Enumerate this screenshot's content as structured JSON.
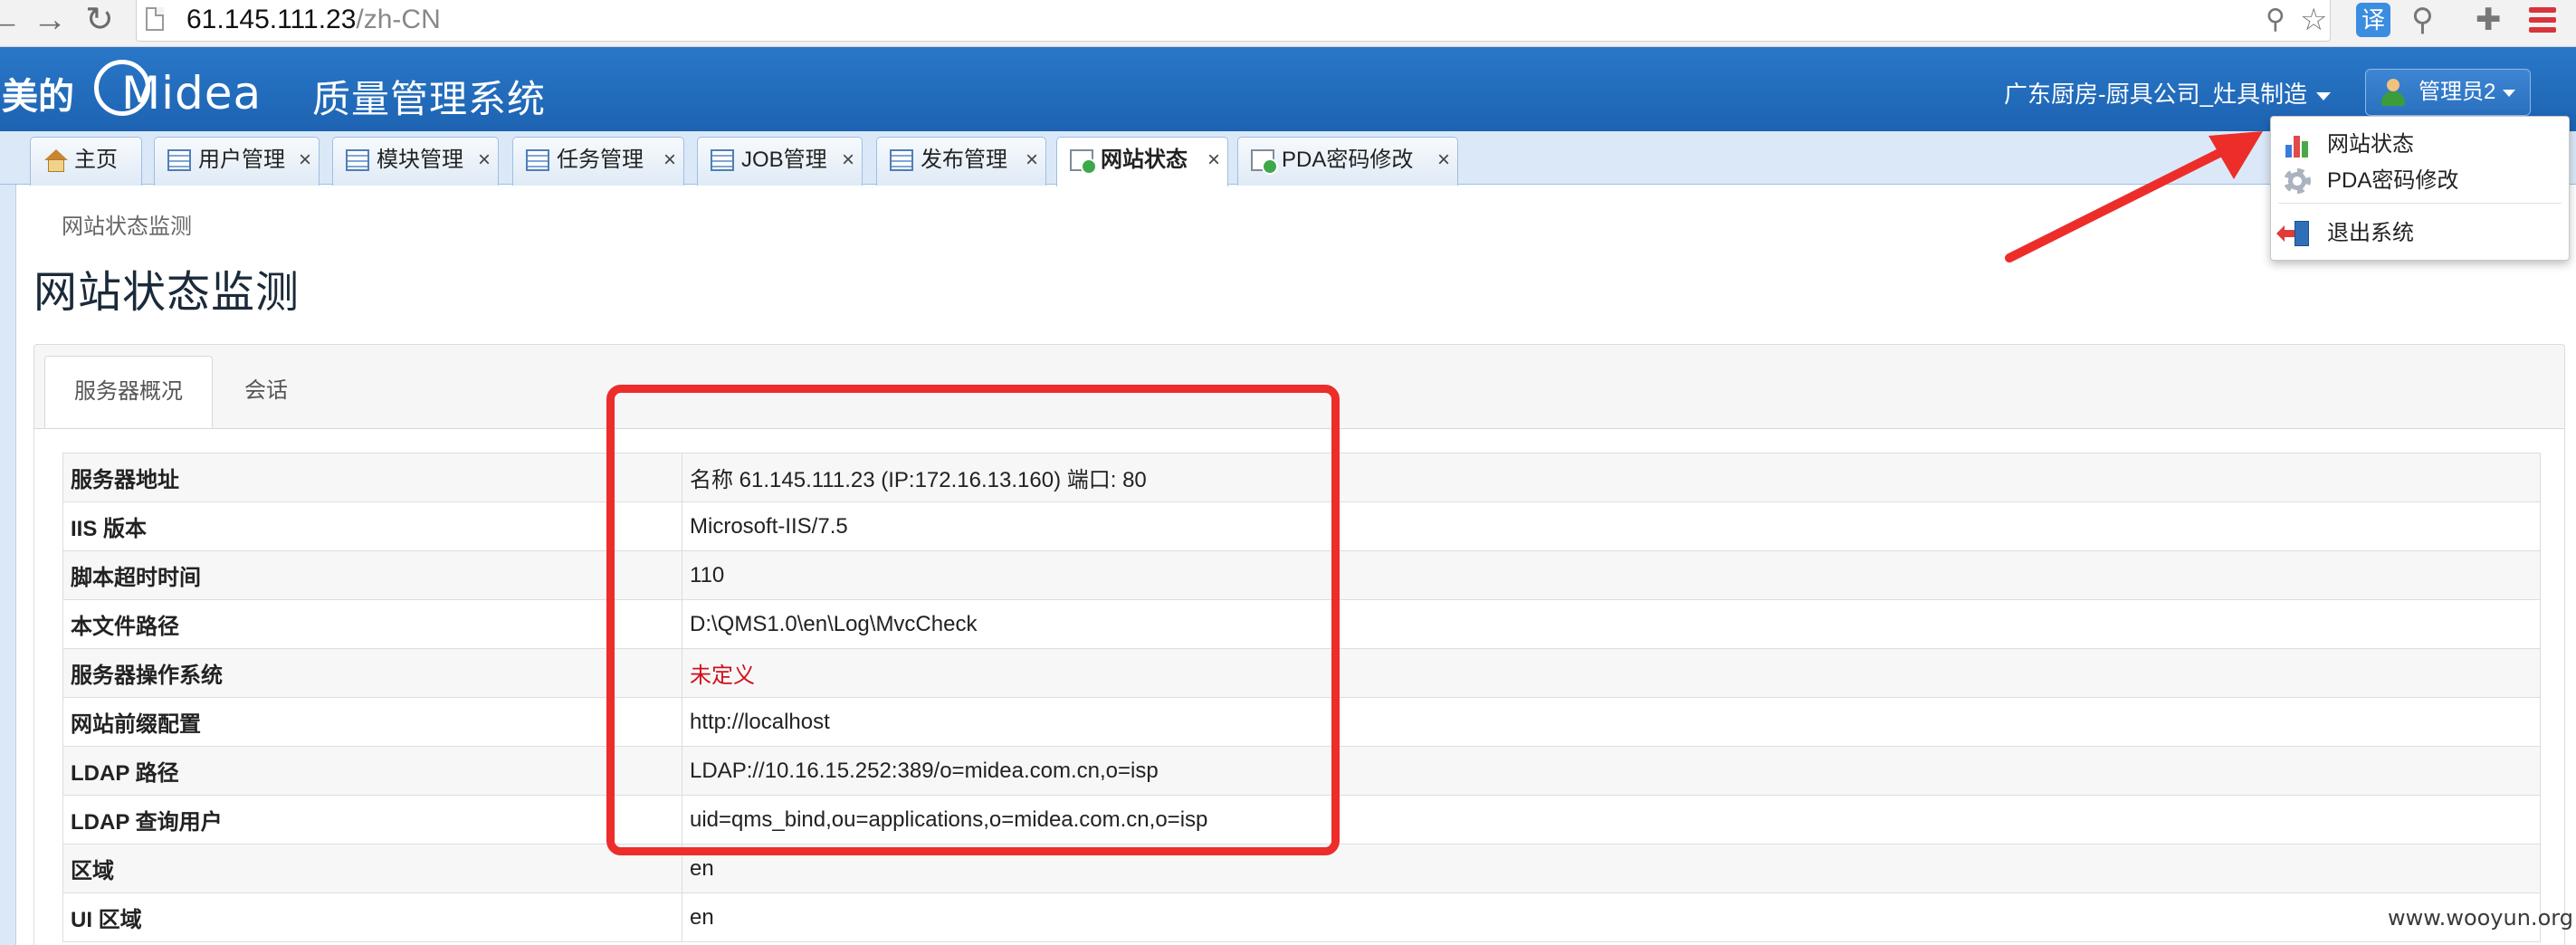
{
  "browser": {
    "url_host": "61.145.111.23",
    "url_path": "/zh-CN",
    "translate_label": "译"
  },
  "header": {
    "brand_cn": "美的",
    "brand_logo": "Midea",
    "system_title": "质量管理系统",
    "org_select": "广东厨房-厨具公司_灶具制造",
    "user_label": "管理员2",
    "color_primary": "#1d63b2"
  },
  "tabs": [
    {
      "label": "主页",
      "icon": "home-icon",
      "closable": false
    },
    {
      "label": "用户管理",
      "icon": "grid-icon",
      "closable": true
    },
    {
      "label": "模块管理",
      "icon": "grid-icon",
      "closable": true
    },
    {
      "label": "任务管理",
      "icon": "grid-icon",
      "closable": true
    },
    {
      "label": "JOB管理",
      "icon": "grid-icon",
      "closable": true
    },
    {
      "label": "发布管理",
      "icon": "grid-icon",
      "closable": true
    },
    {
      "label": "网站状态",
      "icon": "page-add-icon",
      "closable": true,
      "active": true
    },
    {
      "label": "PDA密码修改",
      "icon": "page-add-icon",
      "closable": true
    }
  ],
  "tab_close_glyph": "×",
  "content": {
    "breadcrumb": "网站状态监测",
    "page_title": "网站状态监测",
    "subtabs": [
      "服务器概况",
      "会话"
    ],
    "rows": [
      {
        "key": "服务器地址",
        "value": "名称 61.145.111.23 (IP:172.16.13.160) 端口: 80"
      },
      {
        "key": "IIS 版本",
        "value": "Microsoft-IIS/7.5"
      },
      {
        "key": "脚本超时时间",
        "value": "110"
      },
      {
        "key": "本文件路径",
        "value": "D:\\QMS1.0\\en\\Log\\MvcCheck"
      },
      {
        "key": "服务器操作系统",
        "value": "未定义"
      },
      {
        "key": "网站前缀配置",
        "value": "http://localhost"
      },
      {
        "key": "LDAP 路径",
        "value": "LDAP://10.16.15.252:389/o=midea.com.cn,o=isp"
      },
      {
        "key": "LDAP 查询用户",
        "value": "uid=qms_bind,ou=applications,o=midea.com.cn,o=isp"
      },
      {
        "key": "区域",
        "value": "en"
      },
      {
        "key": "UI 区域",
        "value": "en"
      }
    ]
  },
  "user_menu": {
    "items": [
      {
        "label": "网站状态",
        "icon": "bar-chart-icon"
      },
      {
        "label": "PDA密码修改",
        "icon": "gear-icon"
      },
      {
        "label": "退出系统",
        "icon": "exit-door-icon"
      }
    ]
  },
  "annotation": {
    "color": "#ec2d2a"
  },
  "watermark": "www.wooyun.org"
}
